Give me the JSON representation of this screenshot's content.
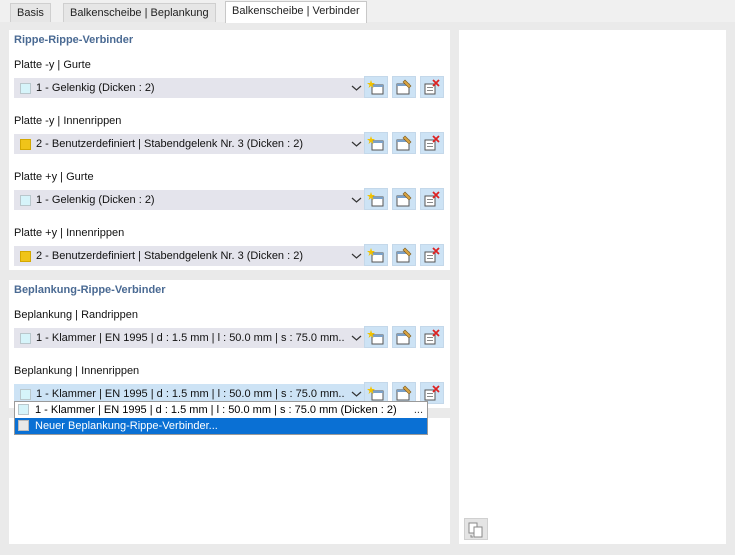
{
  "tabs": [
    {
      "label": "Basis"
    },
    {
      "label": "Balkenscheibe | Beplankung"
    },
    {
      "label": "Balkenscheibe | Verbinder"
    }
  ],
  "sections": [
    {
      "title": "Rippe-Rippe-Verbinder",
      "fields": [
        {
          "label": "Platte -y | Gurte",
          "value": "1 - Gelenkig (Dicken : 2)",
          "swatch": "#d6f4fa"
        },
        {
          "label": "Platte -y | Innenrippen",
          "value": "2 - Benutzerdefiniert | Stabendgelenk Nr. 3 (Dicken : 2)",
          "swatch": "#f0c419"
        },
        {
          "label": "Platte +y | Gurte",
          "value": "1 - Gelenkig (Dicken : 2)",
          "swatch": "#d6f4fa"
        },
        {
          "label": "Platte +y | Innenrippen",
          "value": "2 - Benutzerdefiniert | Stabendgelenk Nr. 3 (Dicken : 2)",
          "swatch": "#f0c419"
        }
      ]
    },
    {
      "title": "Beplankung-Rippe-Verbinder",
      "fields": [
        {
          "label": "Beplankung | Randrippen",
          "value": "1 - Klammer | EN 1995 | d : 1.5 mm | l : 50.0 mm | s : 75.0 mm...",
          "swatch": "#d6f4fa"
        },
        {
          "label": "Beplankung | Innenrippen",
          "value": "1 - Klammer | EN 1995 | d : 1.5 mm | l : 50.0 mm | s : 75.0 mm...",
          "swatch": "#d6f4fa"
        }
      ]
    }
  ],
  "dropdown": {
    "items": [
      {
        "text": "1 - Klammer | EN 1995 | d : 1.5 mm | l : 50.0 mm | s : 75.0 mm (Dicken : 2)",
        "swatch": "#d6f4fa",
        "selected": false
      },
      {
        "text": "Neuer Beplankung-Rippe-Verbinder...",
        "swatch": "#e8e8e8",
        "selected": true
      }
    ],
    "more_label": "..."
  },
  "icons": {
    "new": "new-item-icon",
    "edit": "edit-item-icon",
    "delete": "delete-item-icon",
    "chevron": "chevron-down-icon",
    "corner": "transfer-icon"
  },
  "colors": {
    "section_title": "#4a6a93",
    "combo_bg": "#e4e4ec",
    "button_bg": "#cde3f5",
    "selection": "#0a70d4"
  }
}
